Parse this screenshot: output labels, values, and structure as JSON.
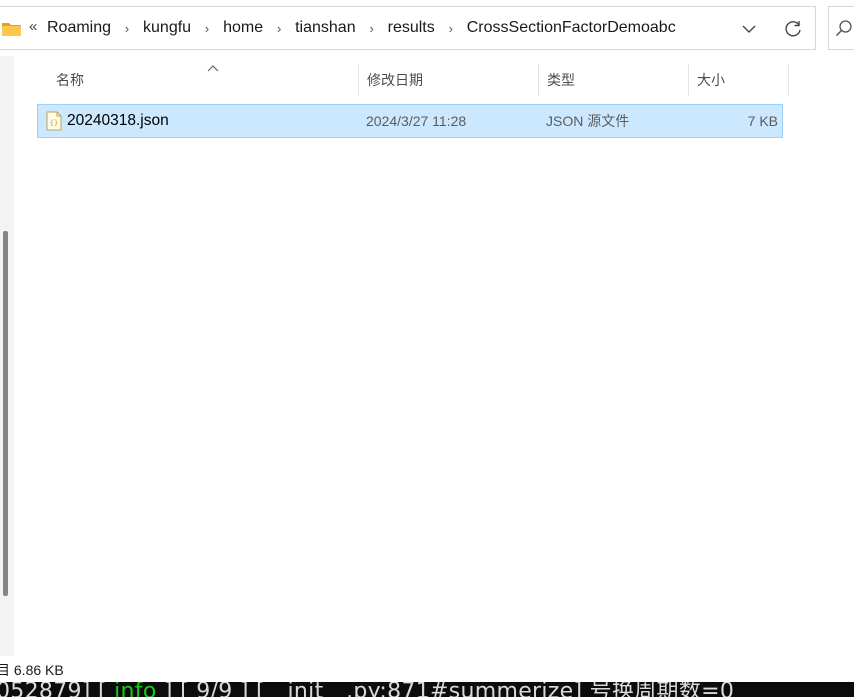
{
  "address": {
    "overflow_glyph": "«",
    "breadcrumbs": [
      "Roaming",
      "kungfu",
      "home",
      "tianshan",
      "results",
      "CrossSectionFactorDemoabc"
    ],
    "separator": "›"
  },
  "columns": [
    {
      "label": "名称"
    },
    {
      "label": "修改日期"
    },
    {
      "label": "类型"
    },
    {
      "label": "大小"
    }
  ],
  "files": [
    {
      "name": "20240318.json",
      "modified": "2024/3/27 11:28",
      "type": "JSON 源文件",
      "size": "7 KB",
      "icon": "json-file-icon"
    }
  ],
  "status": {
    "text": "目  6.86 KB"
  },
  "terminal": {
    "pre": "052879] [ ",
    "level": "info",
    "post": " ] [ 9/9 ] [__init__.py:871#summerize] 号换周期数=0"
  },
  "colors": {
    "selection_bg": "#cce8ff",
    "selection_border": "#99d1ff",
    "folder": "#f5c342"
  }
}
